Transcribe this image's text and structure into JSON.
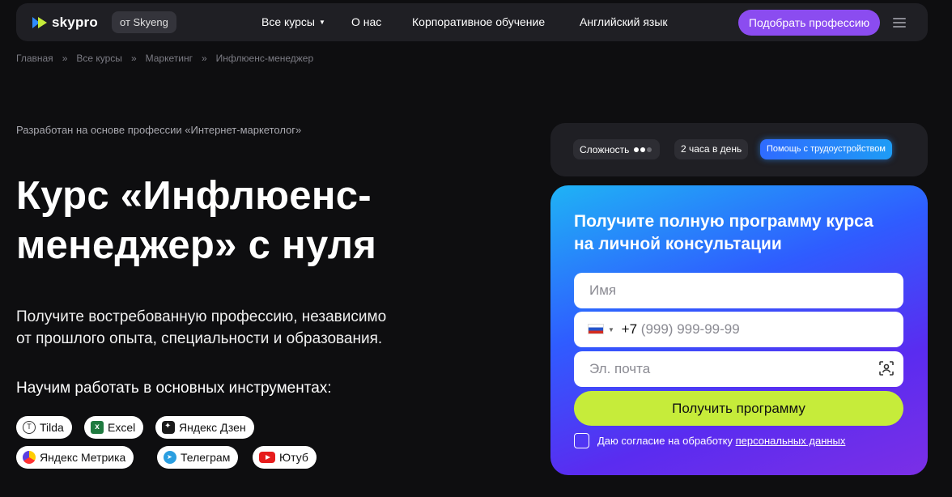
{
  "nav": {
    "logo_text": "skypro",
    "from_badge": "от Skyeng",
    "links": [
      "Все курсы",
      "О нас",
      "Корпоративное обучение",
      "Английский язык"
    ],
    "cta": "Подобрать профессию"
  },
  "breadcrumb": [
    "Главная",
    "Все курсы",
    "Маркетинг",
    "Инфлюенс-менеджер"
  ],
  "breadcrumb_sep": "»",
  "hero": {
    "subtitle": "Разработан на основе профессии «Интернет-маркетолог»",
    "title_line1": "Курс «Инфлюенс-",
    "title_line2": "менеджер» с нуля",
    "desc_line1": "Получите востребованную профессию, независимо",
    "desc_line2": "от прошлого опыта, специальности и образования.",
    "tools_title": "Научим работать в основных инструментах:"
  },
  "tools": [
    {
      "label": "Tilda",
      "icon": "tilda-icon"
    },
    {
      "label": "Excel",
      "icon": "excel-icon"
    },
    {
      "label": "Яндекс Дзен",
      "icon": "dzen-icon"
    },
    {
      "label": "Яндекс Метрика",
      "icon": "metrika-icon"
    },
    {
      "label": "Телеграм",
      "icon": "telegram-icon"
    },
    {
      "label": "Ютуб",
      "icon": "youtube-icon"
    }
  ],
  "info": {
    "difficulty_label": "Сложность",
    "difficulty_level": 2,
    "difficulty_max": 3,
    "hours": "2 часа в день",
    "job_help": "Помощь с трудоустройством"
  },
  "form": {
    "title_line1": "Получите полную программу курса",
    "title_line2": "на личной консультации",
    "name_placeholder": "Имя",
    "phone_prefix": "+7",
    "phone_placeholder": "(999) 999-99-99",
    "email_placeholder": "Эл. почта",
    "submit": "Получить программу",
    "consent_text": "Даю согласие на обработку",
    "consent_link": "персональных данных"
  },
  "colors": {
    "accent_purple": "#8b4cf0",
    "submit_green": "#c6ec3a",
    "background": "#0e0e10"
  }
}
